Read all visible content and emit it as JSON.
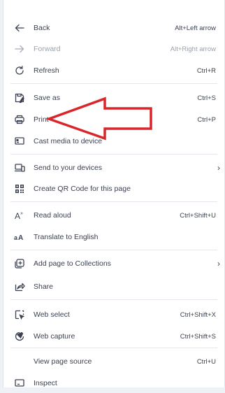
{
  "top_partial": "...",
  "menu": {
    "items": [
      {
        "label": "Back",
        "shortcut": "Alt+Left arrow",
        "icon": "back-arrow-icon",
        "enabled": true
      },
      {
        "label": "Forward",
        "shortcut": "Alt+Right arrow",
        "icon": "forward-arrow-icon",
        "enabled": false
      },
      {
        "label": "Refresh",
        "shortcut": "Ctrl+R",
        "icon": "refresh-icon",
        "enabled": true
      },
      {
        "label": "Save as",
        "shortcut": "Ctrl+S",
        "icon": "save-as-icon",
        "enabled": true
      },
      {
        "label": "Print",
        "shortcut": "Ctrl+P",
        "icon": "print-icon",
        "enabled": true
      },
      {
        "label": "Cast media to device",
        "shortcut": "",
        "icon": "cast-icon",
        "enabled": true
      },
      {
        "label": "Send to your devices",
        "shortcut": "",
        "icon": "send-to-devices-icon",
        "enabled": true,
        "submenu": true
      },
      {
        "label": "Create QR Code for this page",
        "shortcut": "",
        "icon": "qr-code-icon",
        "enabled": true
      },
      {
        "label": "Read aloud",
        "shortcut": "Ctrl+Shift+U",
        "icon": "read-aloud-icon",
        "enabled": true
      },
      {
        "label": "Translate to English",
        "shortcut": "",
        "icon": "translate-icon",
        "enabled": true
      },
      {
        "label": "Add page to Collections",
        "shortcut": "",
        "icon": "collections-icon",
        "enabled": true,
        "submenu": true
      },
      {
        "label": "Share",
        "shortcut": "",
        "icon": "share-icon",
        "enabled": true
      },
      {
        "label": "Web select",
        "shortcut": "Ctrl+Shift+X",
        "icon": "web-select-icon",
        "enabled": true
      },
      {
        "label": "Web capture",
        "shortcut": "Ctrl+Shift+S",
        "icon": "web-capture-icon",
        "enabled": true
      },
      {
        "label": "View page source",
        "shortcut": "Ctrl+U",
        "icon": "",
        "enabled": true
      },
      {
        "label": "Inspect",
        "shortcut": "",
        "icon": "inspect-icon",
        "enabled": true
      }
    ],
    "submenu_glyph": "›"
  },
  "annotation": {
    "color": "#d9262b",
    "target": "Print"
  }
}
